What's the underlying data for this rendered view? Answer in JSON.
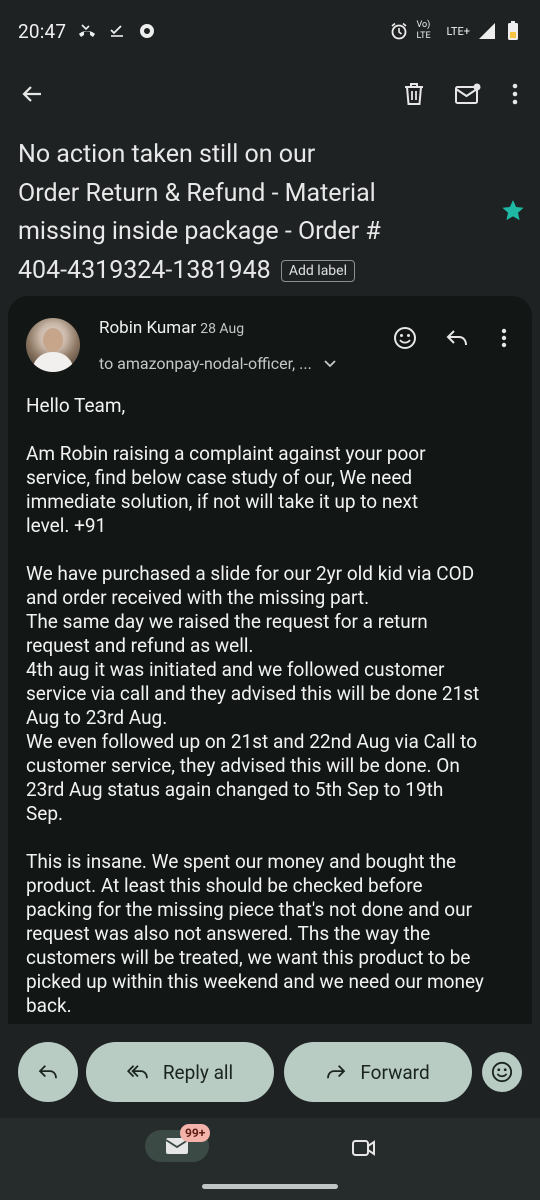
{
  "status_bar": {
    "time": "20:47",
    "network_label": "Vo) LTE",
    "data_label": "LTE+"
  },
  "app_bar": {
    "back_icon": "arrow-back-icon",
    "delete_icon": "trash-icon",
    "mark_unread_icon": "mail-unread-icon",
    "more_icon": "more-vert-icon"
  },
  "email": {
    "subject_line1": "No action taken still on our",
    "subject_line2": "Order Return & Refund - Material",
    "subject_line3": "missing inside package - Order #",
    "subject_line4": "404-4319324-1381948",
    "add_label": "Add label",
    "starred": true,
    "star_color": "#1fb8a4",
    "sender_name": "Robin Kumar",
    "date": "28 Aug",
    "recipients": "to amazonpay-nodal-officer, ...",
    "body": {
      "p1": "Hello Team,",
      "p2": "Am Robin raising a complaint against your poor\nservice, find below case study of our, We need\nimmediate solution, if not will take it up to next\nlevel.  +91",
      "p3": "We have purchased a slide for our 2yr old kid via COD\nand order received with the missing part.\nThe same day we raised the request for a return\nrequest and refund as well.\n4th aug it was initiated and we followed customer\nservice via call and they advised this will be done 21st\nAug to 23rd Aug.\nWe even followed up on 21st and 22nd Aug via Call to\ncustomer service, they advised this will be done. On\n23rd Aug status again changed to 5th Sep to 19th\nSep.",
      "p4": "This is insane. We spent our money and bought the\nproduct. At least this should be checked before\npacking for the missing piece  that's not done and our\nrequest was also not answered. Ths the way the\ncustomers will be treated, we want this product to be\npicked up within this weekend and we need our money\nback."
    }
  },
  "actions": {
    "reply_all_label": "Reply all",
    "forward_label": "Forward"
  },
  "bottom_nav": {
    "mail_badge": "99+",
    "mail_icon": "mail-icon",
    "meet_icon": "video-icon"
  }
}
